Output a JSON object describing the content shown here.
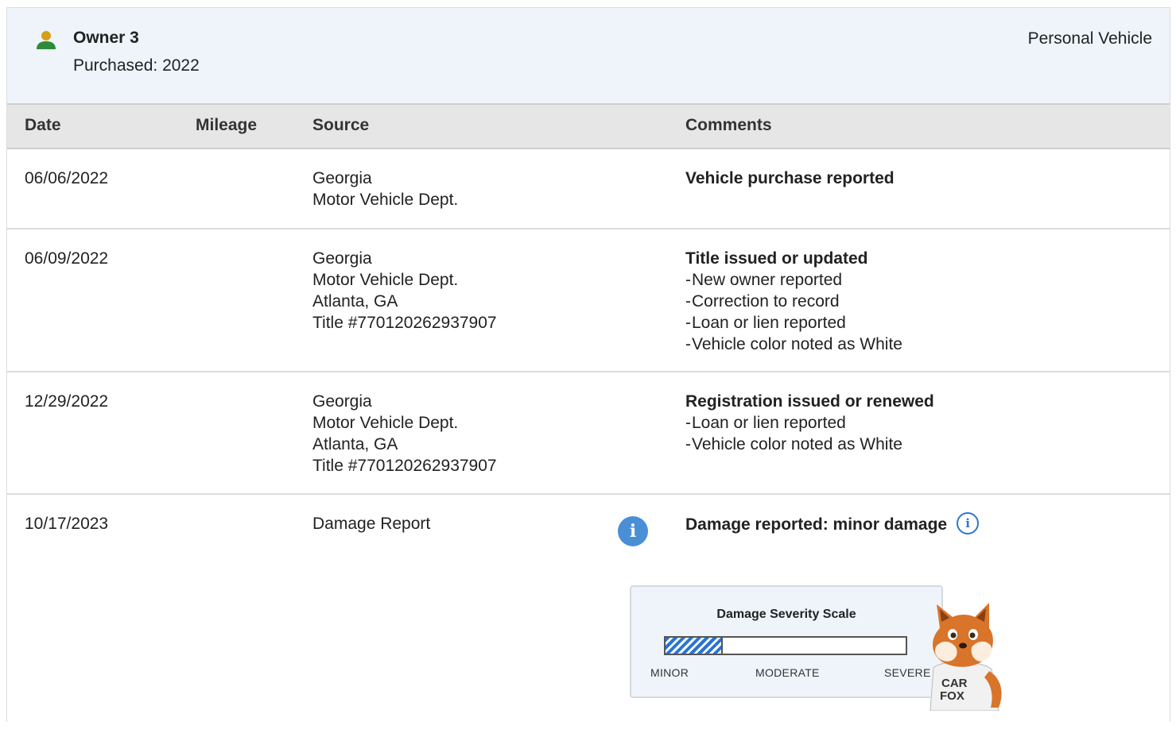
{
  "owner": {
    "title": "Owner 3",
    "purchased": "Purchased: 2022",
    "vehicle_type": "Personal Vehicle",
    "icon": "person-icon",
    "icon_color": "#2e8b3a"
  },
  "columns": {
    "date": "Date",
    "mileage": "Mileage",
    "source": "Source",
    "comments": "Comments"
  },
  "rows": [
    {
      "date": "06/06/2022",
      "source": [
        "Georgia",
        "Motor Vehicle Dept."
      ],
      "comment_title": "Vehicle purchase reported",
      "comment_items": []
    },
    {
      "date": "06/09/2022",
      "source": [
        "Georgia",
        "Motor Vehicle Dept.",
        "Atlanta, GA",
        "Title #770120262937907"
      ],
      "comment_title": "Title issued or updated",
      "comment_items": [
        "New owner reported",
        "Correction to record",
        "Loan or lien reported",
        "Vehicle color noted as White"
      ]
    },
    {
      "date": "12/29/2022",
      "source": [
        "Georgia",
        "Motor Vehicle Dept.",
        "Atlanta, GA",
        "Title #770120262937907"
      ],
      "comment_title": "Registration issued or renewed",
      "comment_items": [
        "Loan or lien reported",
        "Vehicle color noted as White"
      ]
    },
    {
      "date": "10/17/2023",
      "source": [
        "Damage Report"
      ],
      "source_info_icon": "info-icon",
      "comment_title": "Damage reported: minor damage",
      "comment_info_icon": "info-outline-icon",
      "comment_items": []
    }
  ],
  "severity": {
    "title": "Damage Severity Scale",
    "labels": [
      "MINOR",
      "MODERATE",
      "SEVERE"
    ],
    "level_fraction": 0.24,
    "fill_color": "#2b73d0"
  },
  "mascot": {
    "icon": "fox-mascot-icon",
    "shirt_text": [
      "CAR",
      "FOX"
    ]
  },
  "colors": {
    "header_bg": "#eef4fa",
    "table_header_bg": "#e6e6e6",
    "info_blue": "#4a8fd6",
    "link_blue": "#2f77d0"
  }
}
